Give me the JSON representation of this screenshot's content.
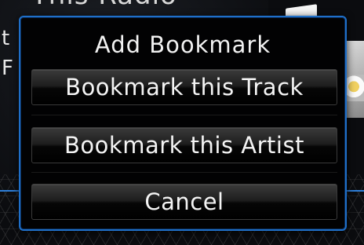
{
  "background": {
    "title": "This Radio",
    "side_text_1": "t",
    "side_text_2": "F"
  },
  "dialog": {
    "title": "Add Bookmark",
    "buttons": {
      "track": "Bookmark this Track",
      "artist": "Bookmark this Artist",
      "cancel": "Cancel"
    }
  },
  "colors": {
    "accent_border": "#1f6fc8",
    "dialog_background": "#020203",
    "button_text": "#f4f4f4"
  }
}
